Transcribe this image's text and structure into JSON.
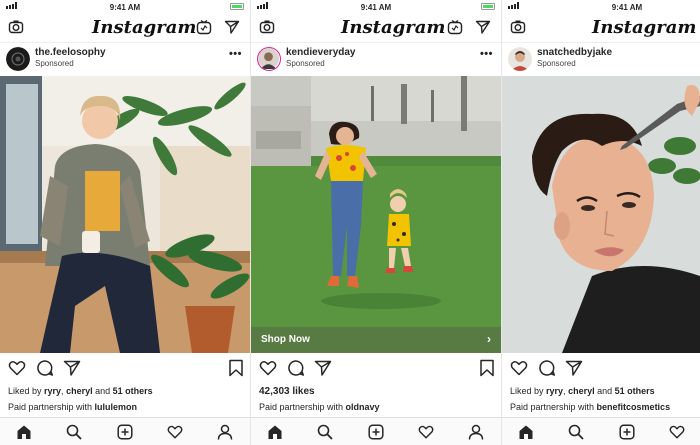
{
  "status_bar": {
    "time": "9:41 AM"
  },
  "app": {
    "logo": "Instagram"
  },
  "colors": {
    "battery": "#4cd964",
    "shop_bar": "#587844",
    "text": "#262626"
  },
  "header_icons": [
    "camera-icon",
    "igtv-icon",
    "direct-message-icon"
  ],
  "post_actions": [
    "heart-icon",
    "comment-icon",
    "share-icon",
    "bookmark-icon"
  ],
  "tab_bar": [
    "home-icon",
    "search-icon",
    "add-post-icon",
    "activity-heart-icon",
    "profile-icon"
  ],
  "posts": [
    {
      "username": "the.feelosophy",
      "sponsored": "Sponsored",
      "more": "•••",
      "likes_prefix": "Liked by ",
      "liker1": "ryry",
      "likes_sep1": ", ",
      "liker2": "cheryl",
      "likes_sep2": " and ",
      "likes_others": "51 others",
      "paid_prefix": "Paid partnership with ",
      "partner": "lululemon"
    },
    {
      "username": "kendieveryday",
      "sponsored": "Sponsored",
      "more": "•••",
      "likes_count": "42,303 likes",
      "shop_now": "Shop Now",
      "shop_chevron": "›",
      "paid_prefix": "Paid partnership with ",
      "partner": "oldnavy"
    },
    {
      "username": "snatchedbyjake",
      "sponsored": "Sponsored",
      "likes_prefix": "Liked by ",
      "liker1": "ryry",
      "likes_sep1": ", ",
      "liker2": "cheryl",
      "likes_sep2": " and ",
      "likes_others": "51 others",
      "paid_prefix": "Paid partnership with ",
      "partner": "benefitcosmetics"
    }
  ]
}
